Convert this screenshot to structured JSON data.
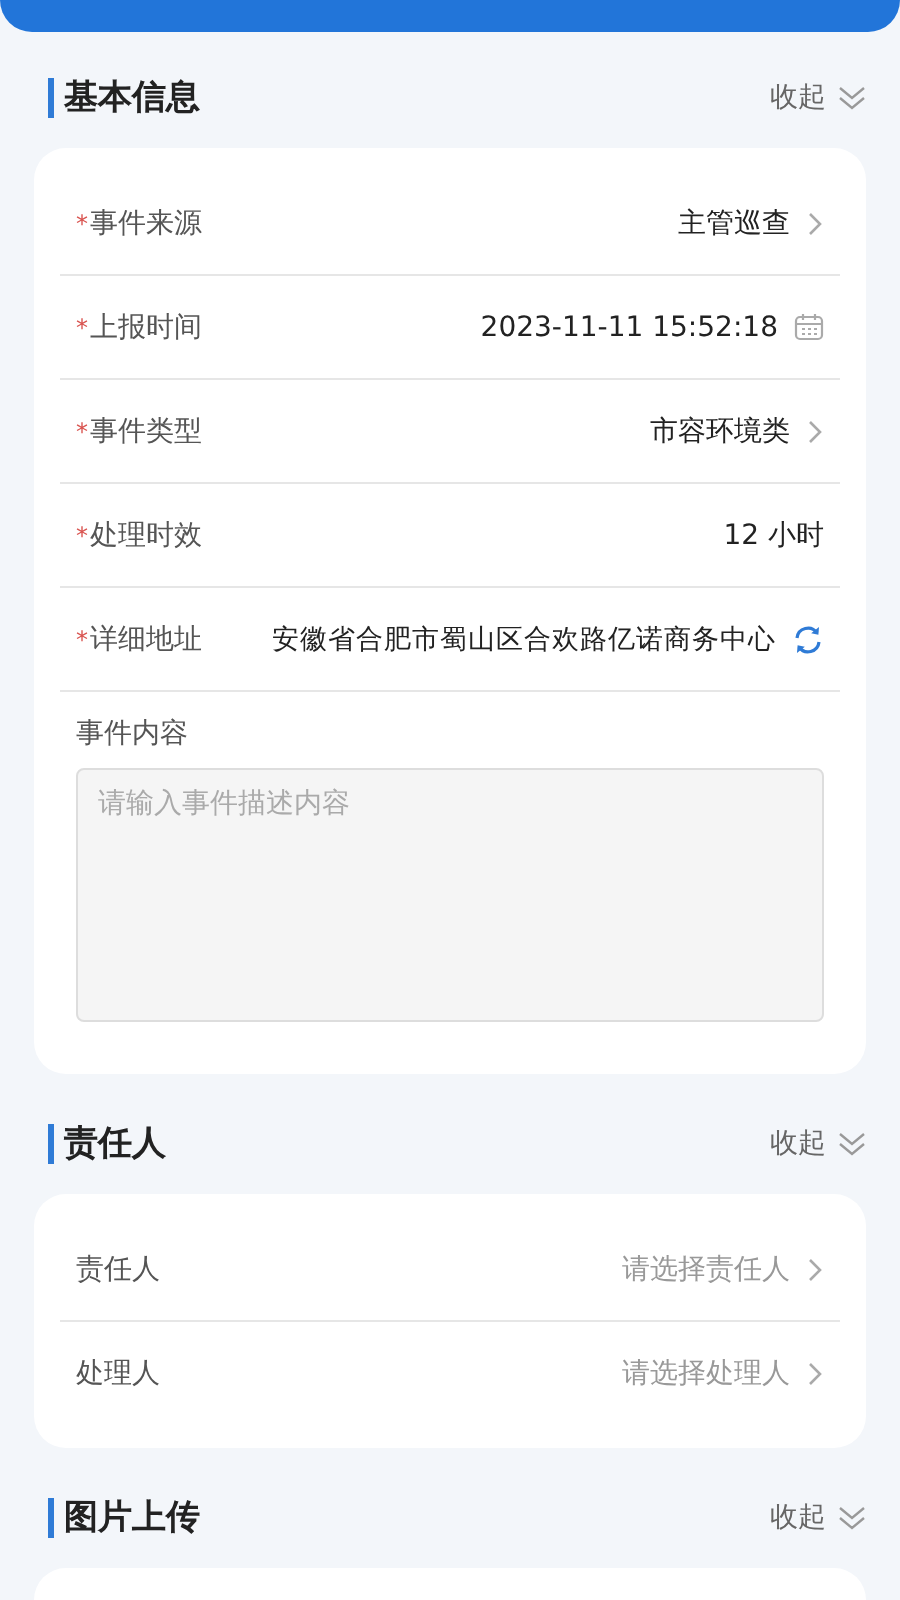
{
  "sections": [
    {
      "title": "基本信息",
      "toggle": "收起",
      "rows": [
        {
          "label": "事件来源",
          "mark": "*",
          "kind": "select",
          "value": "主管巡查"
        },
        {
          "label": "上报时间",
          "mark": "*",
          "kind": "date",
          "value": "2023-11-11 15:52:18"
        },
        {
          "label": "事件类型",
          "mark": "*",
          "kind": "select",
          "value": "市容环境类"
        },
        {
          "label": "处理时效",
          "mark": "*",
          "kind": "text",
          "value": "12 小时"
        },
        {
          "label": "详细地址",
          "mark": "*",
          "kind": "location",
          "value": "安徽省合肥市蜀山区合欢路亿诺商务中心"
        }
      ],
      "textarea": {
        "label": "事件内容",
        "placeholder": "请输入事件描述内容"
      }
    },
    {
      "title": "责任人",
      "toggle": "收起",
      "rows": [
        {
          "label": "责任人",
          "kind": "select",
          "placeholder": "请选择责任人"
        },
        {
          "label": "处理人",
          "kind": "select",
          "placeholder": "请选择处理人"
        }
      ]
    },
    {
      "title": "图片上传",
      "toggle": "收起"
    }
  ]
}
